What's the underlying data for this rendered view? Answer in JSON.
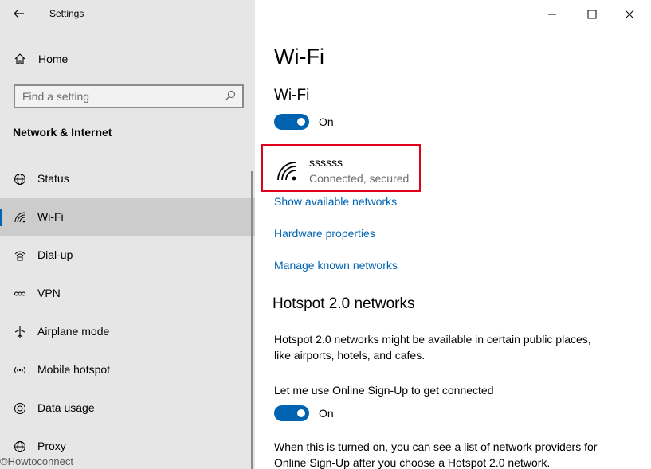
{
  "window": {
    "title": "Settings"
  },
  "titlebar": {
    "back_icon": "back-arrow-icon",
    "minimize_icon": "minimize-icon",
    "maximize_icon": "maximize-icon",
    "close_icon": "close-icon"
  },
  "sidebar": {
    "home_label": "Home",
    "search_placeholder": "Find a setting",
    "section_title": "Network & Internet",
    "items": [
      {
        "label": "Status",
        "icon": "globe-icon"
      },
      {
        "label": "Wi-Fi",
        "icon": "wifi-icon",
        "active": true
      },
      {
        "label": "Dial-up",
        "icon": "dialup-icon"
      },
      {
        "label": "VPN",
        "icon": "vpn-icon"
      },
      {
        "label": "Airplane mode",
        "icon": "airplane-icon"
      },
      {
        "label": "Mobile hotspot",
        "icon": "hotspot-icon"
      },
      {
        "label": "Data usage",
        "icon": "data-usage-icon"
      },
      {
        "label": "Proxy",
        "icon": "proxy-globe-icon"
      }
    ]
  },
  "main": {
    "page_title": "Wi-Fi",
    "wifi_section_title": "Wi-Fi",
    "wifi_toggle_label": "On",
    "network": {
      "name": "ssssss",
      "status": "Connected, secured"
    },
    "links": [
      "Show available networks",
      "Hardware properties",
      "Manage known networks"
    ],
    "hotspot_title": "Hotspot 2.0 networks",
    "hotspot_desc_line1": "Hotspot 2.0 networks might be available in certain public places,",
    "hotspot_desc_line2": "like airports, hotels, and cafes.",
    "signup_label": "Let me use Online Sign-Up to get connected",
    "signup_toggle_label": "On",
    "signup_desc_line1": "When this is turned on, you can see a list of network providers for",
    "signup_desc_line2": "Online Sign-Up after you choose a Hotspot 2.0 network."
  },
  "watermark": "©Howtoconnect",
  "colors": {
    "accent": "#0063b1",
    "highlight_box": "#e0001b",
    "sidebar_bg": "#e6e6e6",
    "active_bg": "#cccccc"
  }
}
